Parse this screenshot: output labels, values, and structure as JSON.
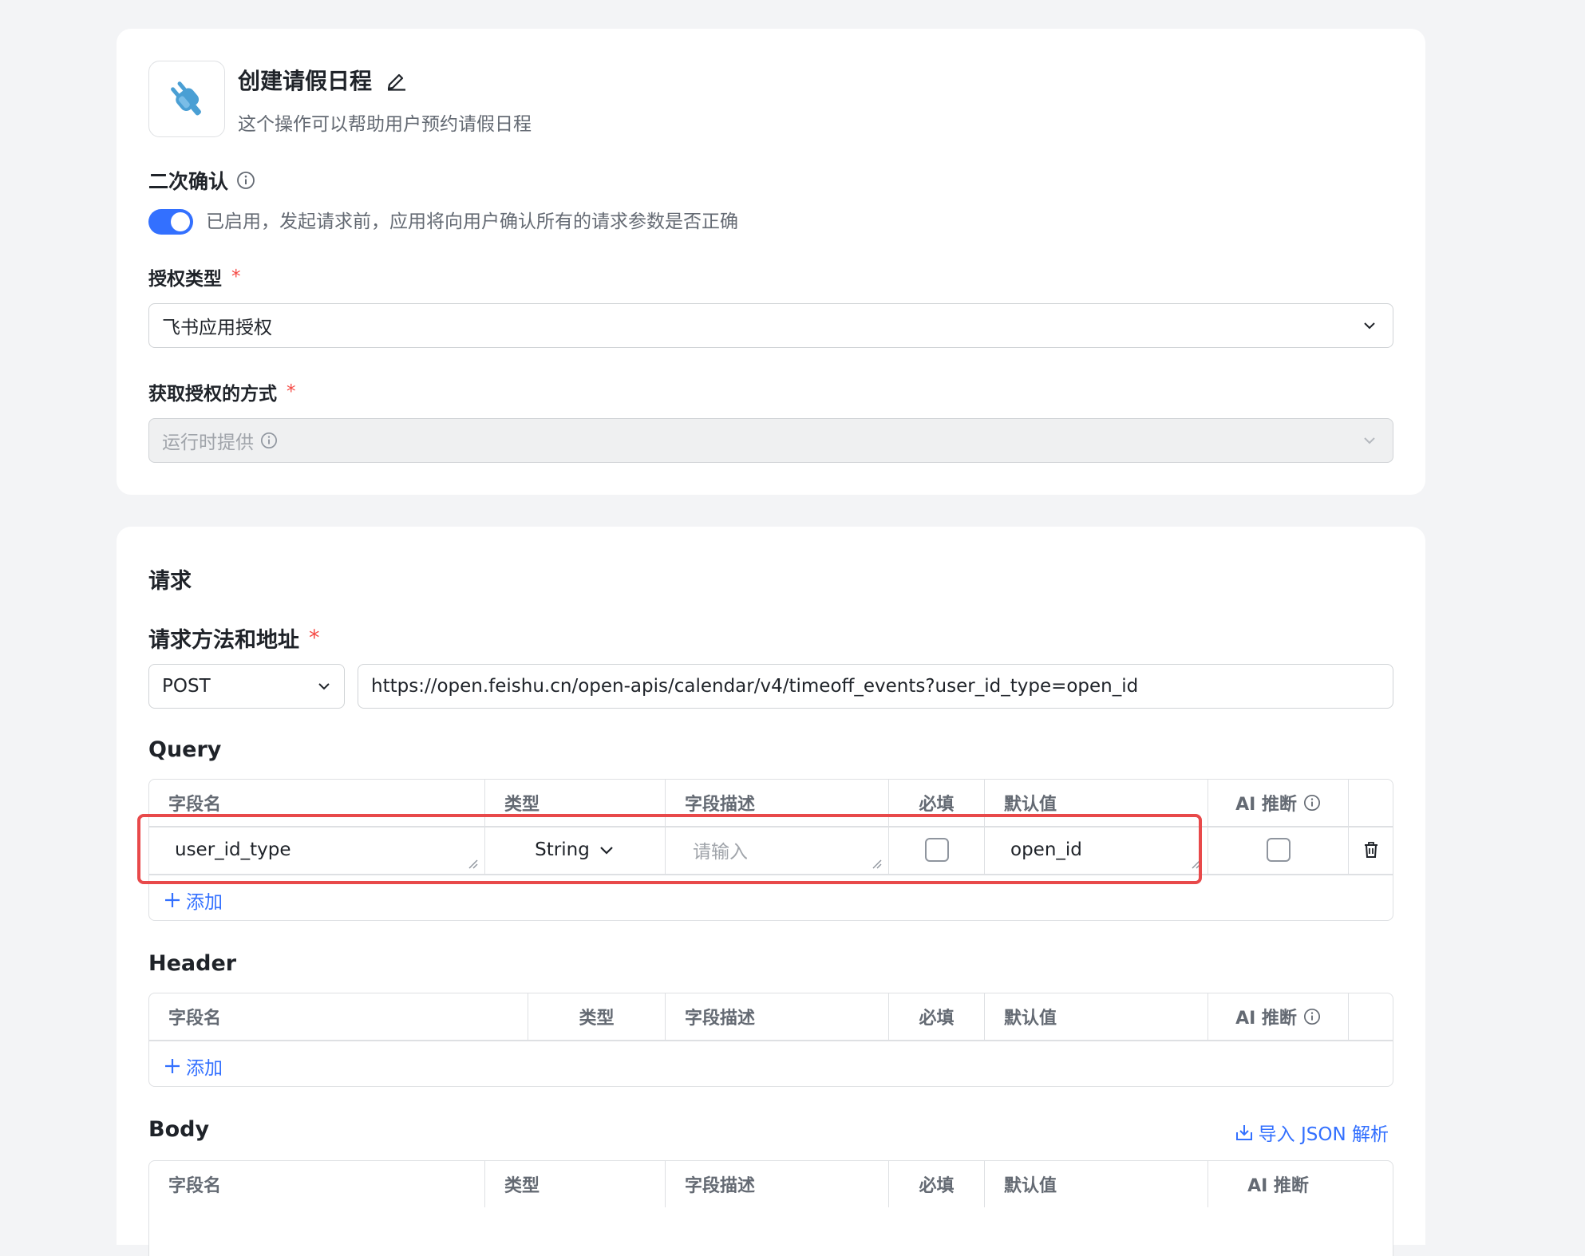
{
  "action": {
    "title": "创建请假日程",
    "description": "这个操作可以帮助用户预约请假日程",
    "icon": "plug-icon",
    "edit_icon": "pencil-icon"
  },
  "confirm": {
    "label": "二次确认",
    "enabled": true,
    "toggle_text": "已启用，发起请求前，应用将向用户确认所有的请求参数是否正确"
  },
  "auth_type": {
    "label": "授权类型",
    "required_mark": "*",
    "value": "飞书应用授权"
  },
  "auth_method": {
    "label": "获取授权的方式",
    "required_mark": "*",
    "value": "运行时提供"
  },
  "request": {
    "title": "请求",
    "method_label": "请求方法和地址",
    "required_mark": "*",
    "method": "POST",
    "url": "https://open.feishu.cn/open-apis/calendar/v4/timeoff_events?user_id_type=open_id"
  },
  "columns": {
    "name": "字段名",
    "type": "类型",
    "desc": "字段描述",
    "required": "必填",
    "default": "默认值",
    "ai": "AI 推断"
  },
  "query": {
    "title": "Query",
    "rows": [
      {
        "name": "user_id_type",
        "type": "String",
        "desc_placeholder": "请输入",
        "required": false,
        "default": "open_id",
        "ai": false
      }
    ],
    "add_label": "添加"
  },
  "header": {
    "title": "Header",
    "add_label": "添加"
  },
  "body": {
    "title": "Body",
    "import_label": "导入 JSON 解析"
  },
  "colors": {
    "accent": "#3370ff",
    "highlight": "#e8494a",
    "required": "#f54a45"
  }
}
